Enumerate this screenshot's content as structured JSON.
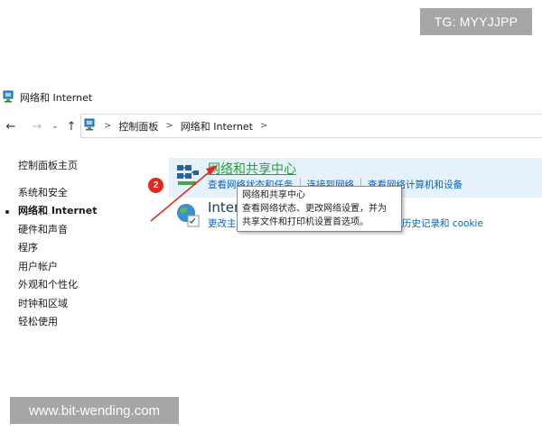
{
  "watermarks": {
    "top": "TG: MYYJJPP",
    "bottom": "www.bit-wending.com"
  },
  "window": {
    "title": "网络和 Internet"
  },
  "nav": {
    "back_icon": "arrow-left-icon",
    "forward_icon": "arrow-right-icon",
    "recent_icon": "chevron-down-icon",
    "up_icon": "arrow-up-icon"
  },
  "address": {
    "segments": [
      "控制面板",
      "网络和 Internet"
    ]
  },
  "sidebar": {
    "home": "控制面板主页",
    "items": [
      {
        "label": "系统和安全",
        "active": false
      },
      {
        "label": "网络和 Internet",
        "active": true
      },
      {
        "label": "硬件和声音",
        "active": false
      },
      {
        "label": "程序",
        "active": false
      },
      {
        "label": "用户帐户",
        "active": false
      },
      {
        "label": "外观和个性化",
        "active": false
      },
      {
        "label": "时钟和区域",
        "active": false
      },
      {
        "label": "轻松使用",
        "active": false
      }
    ]
  },
  "categories": [
    {
      "title": "网络和共享中心",
      "icon": "network-sharing-center-icon",
      "links": [
        "查看网络状态和任务",
        "连接到网络",
        "查看网络计算机和设备"
      ]
    },
    {
      "title": "Intern",
      "icon": "internet-options-icon",
      "links": [
        "更改主",
        "的历史记录和 cookie"
      ]
    }
  ],
  "tooltip": {
    "title": "网络和共享中心",
    "body": "查看网络状态、更改网络设置，并为\n共享文件和打印机设置首选项。"
  },
  "annotation": {
    "badge": "2",
    "color": "#e02a20"
  },
  "colors": {
    "link": "#0b62c0",
    "category_hover_bg": "#e6f2fb",
    "hovered_title": "#2a9d39"
  }
}
